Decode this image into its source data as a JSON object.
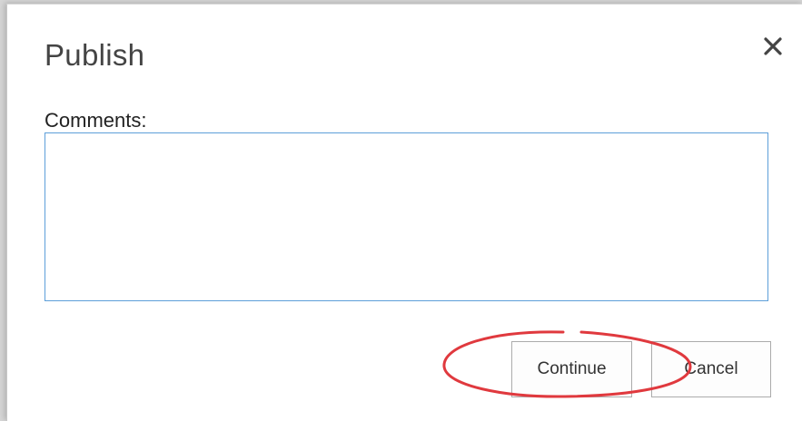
{
  "dialog": {
    "title": "Publish",
    "close_icon": "close-icon",
    "comments_label": "Comments:",
    "comments_value": "",
    "continue_label": "Continue",
    "cancel_label": "Cancel"
  },
  "annotation": {
    "shape": "ellipse",
    "color": "#e0393e",
    "highlights": "continue-button"
  }
}
